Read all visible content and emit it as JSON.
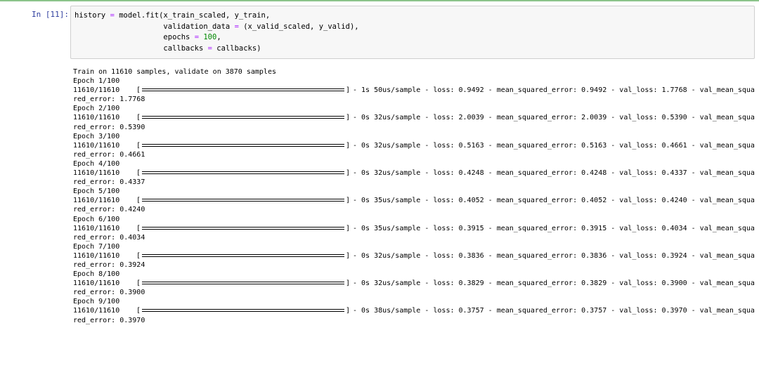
{
  "cell": {
    "prompt": "In  [11]:",
    "code_lines": [
      [
        {
          "t": "history "
        },
        {
          "t": "=",
          "c": "op"
        },
        {
          "t": " model.fit(x_train_scaled, y_train,"
        }
      ],
      [
        {
          "t": "                    validation_data "
        },
        {
          "t": "=",
          "c": "op"
        },
        {
          "t": " (x_valid_scaled, y_valid),"
        }
      ],
      [
        {
          "t": "                    epochs "
        },
        {
          "t": "=",
          "c": "op"
        },
        {
          "t": " "
        },
        {
          "t": "100",
          "c": "num"
        },
        {
          "t": ","
        }
      ],
      [
        {
          "t": "                    callbacks "
        },
        {
          "t": "=",
          "c": "op"
        },
        {
          "t": " callbacks)"
        }
      ]
    ]
  },
  "output": {
    "header": "Train on 11610 samples, validate on 3870 samples",
    "epochs": [
      {
        "epoch": "Epoch 1/100",
        "count": "11610/11610",
        "progress": 1.0,
        "stats": "- 1s 50us/sample - loss: 0.9492 - mean_squared_error: 0.9492 - val_loss: 1.7768 - val_mean_squa",
        "wrap": "red_error: 1.7768"
      },
      {
        "epoch": "Epoch 2/100",
        "count": "11610/11610",
        "progress": 1.0,
        "stats": "- 0s 32us/sample - loss: 2.0039 - mean_squared_error: 2.0039 - val_loss: 0.5390 - val_mean_squa",
        "wrap": "red_error: 0.5390"
      },
      {
        "epoch": "Epoch 3/100",
        "count": "11610/11610",
        "progress": 1.0,
        "stats": "- 0s 32us/sample - loss: 0.5163 - mean_squared_error: 0.5163 - val_loss: 0.4661 - val_mean_squa",
        "wrap": "red_error: 0.4661"
      },
      {
        "epoch": "Epoch 4/100",
        "count": "11610/11610",
        "progress": 1.0,
        "stats": "- 0s 32us/sample - loss: 0.4248 - mean_squared_error: 0.4248 - val_loss: 0.4337 - val_mean_squa",
        "wrap": "red_error: 0.4337"
      },
      {
        "epoch": "Epoch 5/100",
        "count": "11610/11610",
        "progress": 1.0,
        "stats": "- 0s 35us/sample - loss: 0.4052 - mean_squared_error: 0.4052 - val_loss: 0.4240 - val_mean_squa",
        "wrap": "red_error: 0.4240"
      },
      {
        "epoch": "Epoch 6/100",
        "count": "11610/11610",
        "progress": 1.0,
        "stats": "- 0s 35us/sample - loss: 0.3915 - mean_squared_error: 0.3915 - val_loss: 0.4034 - val_mean_squa",
        "wrap": "red_error: 0.4034"
      },
      {
        "epoch": "Epoch 7/100",
        "count": "11610/11610",
        "progress": 1.0,
        "stats": "- 0s 32us/sample - loss: 0.3836 - mean_squared_error: 0.3836 - val_loss: 0.3924 - val_mean_squa",
        "wrap": "red_error: 0.3924"
      },
      {
        "epoch": "Epoch 8/100",
        "count": "11610/11610",
        "progress": 1.0,
        "stats": "- 0s 32us/sample - loss: 0.3829 - mean_squared_error: 0.3829 - val_loss: 0.3900 - val_mean_squa",
        "wrap": "red_error: 0.3900"
      },
      {
        "epoch": "Epoch 9/100",
        "count": "11610/11610",
        "progress": 1.0,
        "stats": "- 0s 38us/sample - loss: 0.3757 - mean_squared_error: 0.3757 - val_loss: 0.3970 - val_mean_squa",
        "wrap": "red_error: 0.3970"
      }
    ]
  },
  "colors": {
    "prompt": "#303f9f",
    "operator": "#aa22ff",
    "number": "#008800",
    "cell_border": "#8bc48a"
  }
}
